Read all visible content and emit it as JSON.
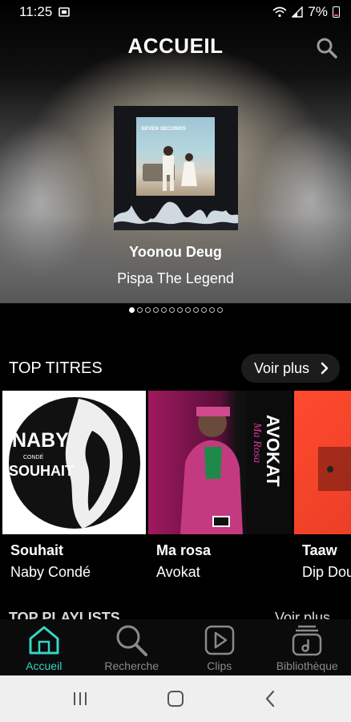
{
  "status": {
    "time": "11:25",
    "battery": "7%"
  },
  "header": {
    "title": "ACCUEIL"
  },
  "featured": {
    "title": "Yoonou Deug",
    "artist": "Pispa The Legend",
    "cover_text": "SEVEN SECONDS",
    "carousel_count": 12,
    "carousel_active": 1
  },
  "top_titres": {
    "title": "TOP TITRES",
    "see_more": "Voir plus",
    "items": [
      {
        "title": "Souhait",
        "artist": "Naby Condé",
        "cover_text_1": "NABY",
        "cover_text_2": "CONDÉ",
        "cover_text_3": "SOUHAIT"
      },
      {
        "title": "Ma rosa",
        "artist": "Avokat",
        "cover_text_1": "AVOKAT",
        "cover_text_2": "Ma Rosa"
      },
      {
        "title": "Taaw",
        "artist": "Dip Dou"
      }
    ]
  },
  "top_playlists": {
    "title": "TOP PLAYLISTS",
    "see_more": "Voir plus"
  },
  "tabbar": {
    "items": [
      {
        "label": "Accueil",
        "icon": "home-icon",
        "active": true
      },
      {
        "label": "Recherche",
        "icon": "search-icon",
        "active": false
      },
      {
        "label": "Clips",
        "icon": "play-icon",
        "active": false
      },
      {
        "label": "Bibliothèque",
        "icon": "library-icon",
        "active": false
      }
    ]
  },
  "colors": {
    "accent": "#35d4c5",
    "background": "#000000",
    "inactive": "#8a8a8a"
  }
}
